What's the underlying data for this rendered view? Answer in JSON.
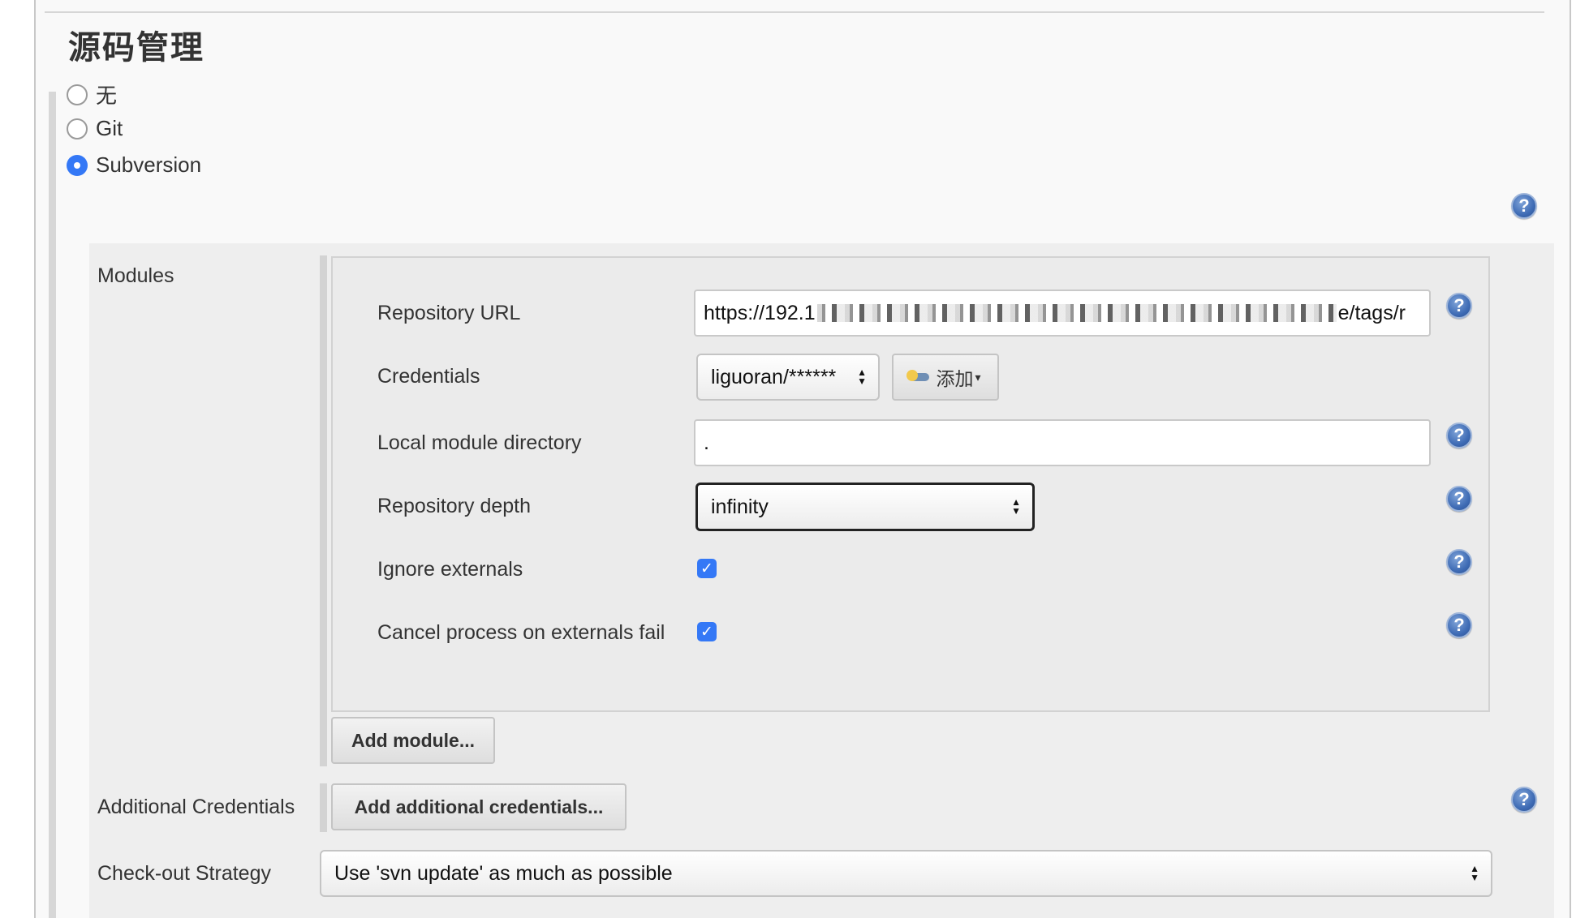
{
  "section": {
    "title": "源码管理"
  },
  "scm_options": [
    {
      "label": "无",
      "selected": false
    },
    {
      "label": "Git",
      "selected": false
    },
    {
      "label": "Subversion",
      "selected": true
    }
  ],
  "subversion": {
    "modules_label": "Modules",
    "module": {
      "repository_url": {
        "label": "Repository URL",
        "value_start": "https://192.1",
        "value_end": "e/tags/r"
      },
      "credentials": {
        "label": "Credentials",
        "selected": "liguoran/******",
        "add_label": "添加"
      },
      "local_module_directory": {
        "label": "Local module directory",
        "value": "."
      },
      "repository_depth": {
        "label": "Repository depth",
        "selected": "infinity"
      },
      "ignore_externals": {
        "label": "Ignore externals",
        "checked": true
      },
      "cancel_process_on_externals_fail": {
        "label": "Cancel process on externals fail",
        "checked": true
      }
    },
    "add_module_label": "Add module...",
    "additional_credentials": {
      "label": "Additional Credentials",
      "button_label": "Add additional credentials..."
    },
    "checkout_strategy": {
      "label": "Check-out Strategy",
      "selected": "Use 'svn update' as much as possible"
    }
  },
  "help_icon_glyph": "?",
  "icons": [
    "help-icon",
    "key-icon",
    "checkmark-icon"
  ],
  "colors": {
    "accent": "#3478f6",
    "panel": "#eeeeee",
    "help_blue": "#3f6cb5"
  }
}
